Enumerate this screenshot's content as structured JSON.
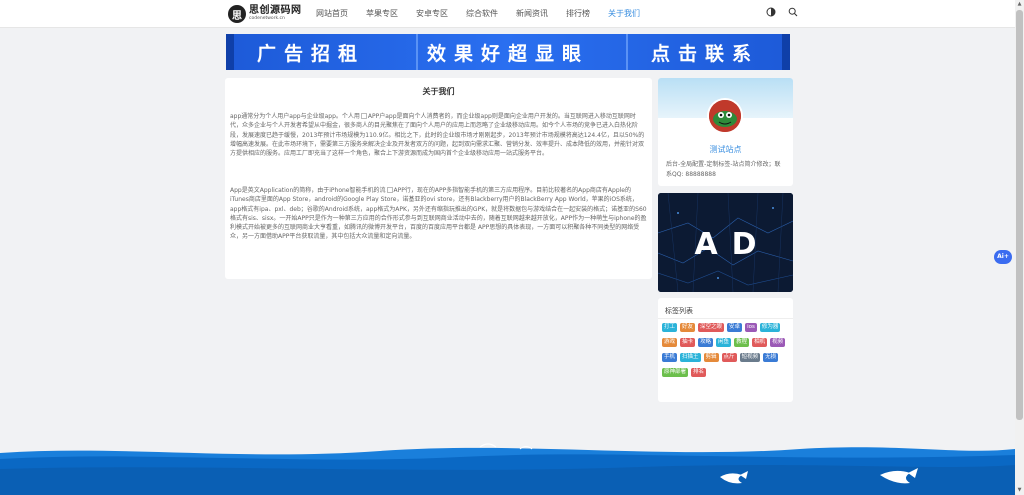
{
  "header": {
    "logo_main": "思创源码网",
    "logo_sub": "codenetwork.cn",
    "logo_mark": "思",
    "nav": [
      {
        "label": "网站首页",
        "active": false
      },
      {
        "label": "苹果专区",
        "active": false
      },
      {
        "label": "安卓专区",
        "active": false
      },
      {
        "label": "综合软件",
        "active": false
      },
      {
        "label": "新闻资讯",
        "active": false
      },
      {
        "label": "排行榜",
        "active": false
      },
      {
        "label": "关于我们",
        "active": true
      }
    ],
    "icons": [
      "theme-toggle-icon",
      "search-icon"
    ]
  },
  "banner": {
    "text1": "广告招租",
    "text2": "效果好超显眼",
    "text3": "点击联系"
  },
  "article": {
    "title": "关于我们",
    "p1a": "app通常分为个人用户app与企业级app。个人用",
    "p1b": "APP户app是面向个人消费者的，而企业级app则是面向企业用户开发的。当互联网进入移动互联网时代，众多企业与个人开发者希望从中掘金，很多商人的目光聚焦在了面向个人用户的应用上而忽略了企业级移动应用。如今个人市场的竞争已进入白热化阶段，发展速度已趋于缓慢，2013年预计市场规模为110.9亿。相比之下，此时的企业级市场才刚刚起步，2013年预计市场规模将高达124.4亿，且以50%的增幅高速发展。在此市场环境下，需要第三方服务来解决企业及开发者双方的问题，起到双向需求汇聚、营销分发、效率提升、成本降低的效用，并能针对双方提供相应的服务。应用工厂即充当了这样一个角色，聚合上下游资源而成为国内首个企业级移动应用一站式服务平台。",
    "p2a": "App是英文Application的简称，由于iPhone智能手机的流",
    "p2b": "APP行，现在的APP多指智能手机的第三方应用程序。目前比较著名的App商店有Apple的iTunes商店里面的App Store，android的Google Play Store，诺基亚的ovi store，还有Blackberry用户的BlackBerry App World，苹果的iOS系统，app格式有ipa、pxl、deb；谷歌的Android系统，app格式为APK，另外还有缩指玩推出的GPK，就是将数据包与游戏结合在一起安装的格式；诺基亚的S60格式有sis、sisx。一开始APP只是作为一种第三方应用的合作形式参与到互联网商业活动中去的，随着互联网越来越开放化，APP作为一种萌生与iphone的盈利模式开始被更多的互联网商业大亨看重，如腾讯的微博开发平台，百度的百度应用平台都是 APP思想的具体表现，一方面可以积聚各种不同类型的网络受众，另一方面借助APP平台获取流量，其中包括大众流量和定向流量。"
  },
  "profile": {
    "site_name": "测试站点",
    "desc": "后台-全局配置-定制标签-站点简介修改；联系QQ: 88888888"
  },
  "ad": {
    "text": "AD"
  },
  "tags": {
    "title": "标签列表",
    "items": [
      {
        "label": "打工",
        "color": "#2bb3d9"
      },
      {
        "label": "好友",
        "color": "#e58a3a"
      },
      {
        "label": "深空之眼",
        "color": "#e05a5a"
      },
      {
        "label": "安卓",
        "color": "#3a7bd5"
      },
      {
        "label": "ios",
        "color": "#9b59b6"
      },
      {
        "label": "修为器",
        "color": "#2bb3d9"
      },
      {
        "label": "游戏",
        "color": "#e58a3a"
      },
      {
        "label": "抽卡",
        "color": "#e05a5a"
      },
      {
        "label": "攻略",
        "color": "#3a7bd5"
      },
      {
        "label": "闲鱼",
        "color": "#2bb3d9"
      },
      {
        "label": "教程",
        "color": "#6cbf4c"
      },
      {
        "label": "相机",
        "color": "#e05a5a"
      },
      {
        "label": "视频",
        "color": "#9b59b6"
      },
      {
        "label": "手机",
        "color": "#3a7bd5"
      },
      {
        "label": "扫描王",
        "color": "#2bb3d9"
      },
      {
        "label": "剪辑",
        "color": "#e58a3a"
      },
      {
        "label": "点斤",
        "color": "#e05a5a"
      },
      {
        "label": "短视频",
        "color": "#6a7b8c"
      },
      {
        "label": "无损",
        "color": "#3a7bd5"
      },
      {
        "label": "原神部署",
        "color": "#6cbf4c"
      },
      {
        "label": "排名",
        "color": "#e05a5a"
      }
    ]
  },
  "ai_button": "Ai+"
}
